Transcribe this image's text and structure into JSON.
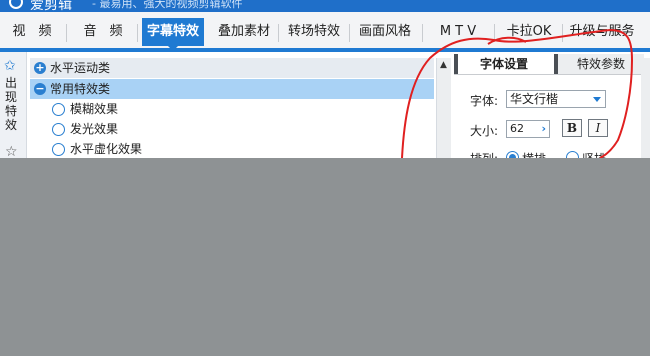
{
  "titlebar": {
    "app_name": "爱剪辑",
    "subtitle": "- 最易用、强大的视频剪辑软件"
  },
  "tabs": [
    {
      "label": "视　频"
    },
    {
      "label": "音　频"
    },
    {
      "label": "字幕特效",
      "active": true
    },
    {
      "label": "叠加素材"
    },
    {
      "label": "转场特效"
    },
    {
      "label": "画面风格"
    },
    {
      "label": "M T V"
    },
    {
      "label": "卡拉OK"
    },
    {
      "label": "升级与服务"
    }
  ],
  "left_strip": {
    "pin_icon": "pin-icon",
    "label": "出现特效",
    "star_icon": "star-icon"
  },
  "tree": {
    "groups": [
      {
        "label": "水平运动类",
        "toggle": "+"
      },
      {
        "label": "常用特效类",
        "toggle": "−",
        "selected": true
      }
    ],
    "items": [
      "模糊效果",
      "发光效果",
      "水平虚化效果"
    ]
  },
  "right_panel": {
    "tabs": [
      {
        "label": "字体设置"
      },
      {
        "label": "特效参数"
      }
    ],
    "font_label": "字体:",
    "font_value": "华文行楷",
    "size_label": "大小:",
    "size_value": "62",
    "bold_label": "B",
    "italic_label": "I",
    "arrange_label": "排列:",
    "arrange_options": [
      "横排",
      "竖排"
    ]
  },
  "colors": {
    "accent": "#1f7ad2",
    "annotation": "#e02020",
    "background": "#8e9294"
  }
}
